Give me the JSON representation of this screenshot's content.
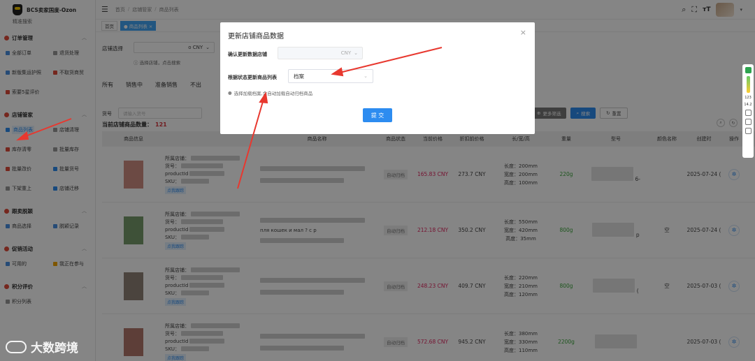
{
  "app": {
    "brand_title": "BCS卖家国度-Ozon",
    "sub_link": "精准搜索"
  },
  "sidebar": {
    "groups": [
      {
        "title": "订单管理",
        "items": [
          "全部订单",
          "退货处理",
          "新版集运护照",
          "不取货商贸",
          "索要5星评价"
        ]
      },
      {
        "title": "店铺管家",
        "items": [
          "商品列表",
          "店铺清理",
          "库存清零",
          "批量库存",
          "批量改价",
          "批量货号",
          "下架重上",
          "店铺迁移"
        ]
      },
      {
        "title": "跟卖脱颖",
        "items": [
          "商品选择",
          "脱颖记录"
        ]
      },
      {
        "title": "促销活动",
        "items": [
          "可用的",
          "我正在参与"
        ]
      },
      {
        "title": "积分评价",
        "items": [
          "积分列表"
        ]
      }
    ]
  },
  "header": {
    "breadcrumb": [
      "首页",
      "店铺管家",
      "商品列表"
    ],
    "tabs": [
      "首页",
      "商品列表"
    ]
  },
  "filter": {
    "shop_label": "店铺选择",
    "shop_value": "o CNY",
    "shop_hint": "选择店铺，点击搜索",
    "status_tabs": [
      "所有",
      "销售中",
      "准备销售",
      "不出"
    ],
    "huohao_label": "货号",
    "huohao_placeholder": "请输入货号",
    "count_label": "当前店铺商品数量：",
    "count_value": "121",
    "btn_more": "更多筛选",
    "btn_search": "搜索",
    "btn_reset": "重置"
  },
  "table": {
    "headers": [
      "商品信息",
      "商品名称",
      "商品状态",
      "当前价格",
      "折扣前价格",
      "长/宽/高",
      "重量",
      "型号",
      "颜色名称",
      "创建时",
      "操作"
    ],
    "info_labels": [
      "所属店铺：",
      "货号：",
      "productId",
      "SKU："
    ],
    "track_btn": "点我跟踪",
    "status_text": "自动归档",
    "dim_labels": [
      "长度：",
      "宽度：",
      "高度："
    ],
    "rows": [
      {
        "name_text": "",
        "price": "165.83 CNY",
        "disc": "273.7 CNY",
        "dims": [
          "200mm",
          "200mm",
          "100mm"
        ],
        "weight": "220g",
        "model": "6-",
        "color": "",
        "date": "2025-07-24 (",
        "thumb": "#c0695a"
      },
      {
        "name_text": "пля кошек и мал ? с р",
        "price": "212.18 CNY",
        "disc": "350.2 CNY",
        "dims": [
          "550mm",
          "420mm",
          "35mm"
        ],
        "weight": "800g",
        "model": "p",
        "color": "空",
        "date": "2025-07-24 (",
        "thumb": "#4a7a3a"
      },
      {
        "name_text": "",
        "price": "248.23 CNY",
        "disc": "409.7 CNY",
        "dims": [
          "220mm",
          "210mm",
          "120mm"
        ],
        "weight": "800g",
        "model": "(",
        "color": "空",
        "date": "2025-07-03 (",
        "thumb": "#6b5a4a"
      },
      {
        "name_text": "",
        "price": "572.68 CNY",
        "disc": "945.2 CNY",
        "dims": [
          "380mm",
          "330mm",
          "110mm"
        ],
        "weight": "2200g",
        "model": "",
        "color": "",
        "date": "2025-07-03 (",
        "thumb": "#9a4a3a"
      }
    ]
  },
  "dialog": {
    "title": "更新店铺商品数据",
    "label_shop": "确认更新数据店铺",
    "shop_value": "CNY",
    "label_status": "根据状态更新商品列表",
    "status_value": "档案",
    "tip": "选择加载档案,会自动加载自动归档商品",
    "submit": "提 交"
  },
  "watermark": "大数跨境",
  "dock": {
    "stat1": "123",
    "stat2": "14.2"
  },
  "colors": {
    "primary": "#2d8cf0",
    "price": "#e0245e",
    "weight": "#3aa53a",
    "accent": "#d9363e"
  }
}
